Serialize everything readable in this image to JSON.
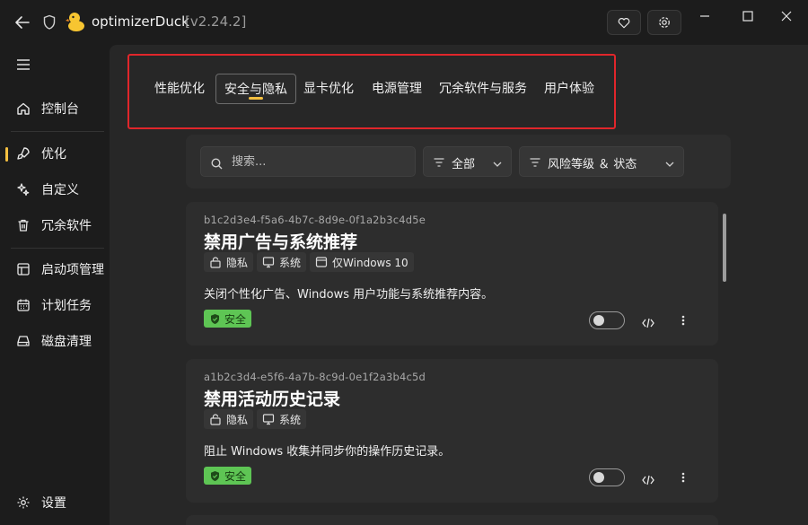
{
  "titlebar": {
    "app_name": "optimizerDuck",
    "version": "[v2.24.2]",
    "icons": [
      "back-arrow-icon",
      "shield-icon",
      "duck-logo",
      "heart-icon",
      "settings-gear-icon"
    ],
    "window_controls": [
      "minimize",
      "maximize",
      "close"
    ]
  },
  "sidebar": {
    "items": [
      {
        "label": "控制台",
        "icon": "home-icon"
      },
      {
        "label": "优化",
        "icon": "rocket-icon",
        "active": true
      },
      {
        "label": "自定义",
        "icon": "sparkle-icon"
      },
      {
        "label": "冗余软件",
        "icon": "trash-icon"
      },
      {
        "label": "启动项管理",
        "icon": "startup-icon"
      },
      {
        "label": "计划任务",
        "icon": "calendar-icon"
      },
      {
        "label": "磁盘清理",
        "icon": "disk-icon"
      }
    ],
    "settings_label": "设置",
    "accent_color": "#f5c040"
  },
  "tabs": [
    {
      "label": "性能优化"
    },
    {
      "label": "安全与隐私",
      "active": true
    },
    {
      "label": "显卡优化"
    },
    {
      "label": "电源管理"
    },
    {
      "label": "冗余软件与服务"
    },
    {
      "label": "用户体验"
    }
  ],
  "filters": {
    "search_placeholder": "搜索...",
    "category_value": "全部",
    "risk_label": "风险等级 ＆ 状态"
  },
  "cards": [
    {
      "id": "b1c2d3e4-f5a6-4b7c-8d9e-0f1a2b3c4d5e",
      "title": "禁用广告与系统推荐",
      "tags": [
        {
          "label": "隐私",
          "icon": "privacy-icon"
        },
        {
          "label": "系统",
          "icon": "monitor-icon"
        },
        {
          "label": "仅Windows 10",
          "icon": "window-icon"
        }
      ],
      "description": "关闭个性化广告、Windows 用户功能与系统推荐内容。",
      "safety": "安全",
      "enabled": false
    },
    {
      "id": "a1b2c3d4-e5f6-4a7b-8c9d-0e1f2a3b4c5d",
      "title": "禁用活动历史记录",
      "tags": [
        {
          "label": "隐私",
          "icon": "privacy-icon"
        },
        {
          "label": "系统",
          "icon": "monitor-icon"
        }
      ],
      "description": "阻止 Windows 收集并同步你的操作历史记录。",
      "safety": "安全",
      "enabled": false
    }
  ],
  "colors": {
    "safe_badge": "#5ec554",
    "highlight_border": "#e0262b",
    "accent": "#f5c040"
  }
}
